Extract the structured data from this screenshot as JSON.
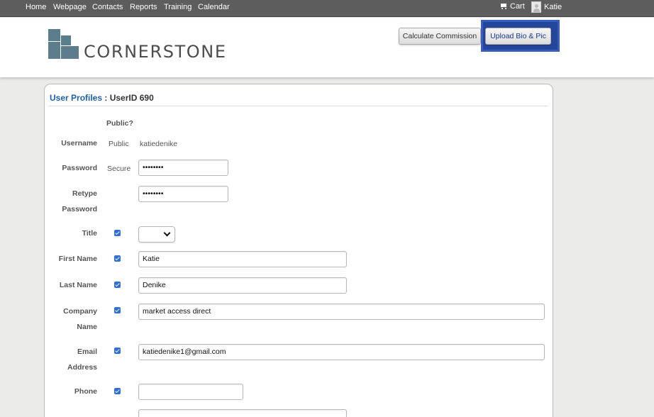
{
  "nav": {
    "items": [
      "Home",
      "Webpage",
      "Contacts",
      "Reports",
      "Training",
      "Calendar"
    ],
    "cart_label": "Cart",
    "user_name": "Katie"
  },
  "header": {
    "logo_text": "CORNERSTONE",
    "calc_button": "Calculate Commission",
    "upload_button": "Upload Bio & Pic"
  },
  "profile": {
    "title_label": "User Profiles",
    "separator": " : ",
    "user_id_text": "UserID 690",
    "public_header": "Public?",
    "fields": {
      "username": {
        "label": "Username",
        "visibility": "Public",
        "value": "katiedenike"
      },
      "password": {
        "label": "Password",
        "visibility": "Secure",
        "value": "••••••••"
      },
      "retype": {
        "label_line1": "Retype",
        "label_line2": "Password",
        "value": "••••••••"
      },
      "title": {
        "label": "Title",
        "public": true,
        "value": ""
      },
      "first_name": {
        "label": "First Name",
        "public": true,
        "value": "Katie"
      },
      "last_name": {
        "label": "Last Name",
        "public": true,
        "value": "Denike"
      },
      "company": {
        "label_line1": "Company",
        "label_line2": "Name",
        "public": true,
        "value": "market access direct"
      },
      "email": {
        "label_line1": "Email",
        "label_line2": "Address",
        "public": true,
        "value": "katiedenike1@gmail.com"
      },
      "phone": {
        "label": "Phone",
        "public": true,
        "value": ""
      }
    }
  },
  "colors": {
    "nav_bg": "#5d5d5d",
    "brand": "#5b7d8c",
    "title_blue": "#1f5fa8",
    "highlight": "#24459c",
    "checkbox": "#2f6fd6"
  }
}
